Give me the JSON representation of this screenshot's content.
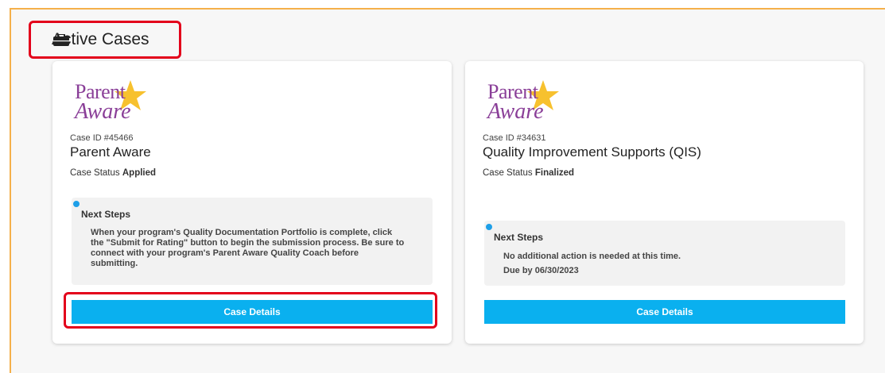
{
  "header": {
    "title": "Active Cases",
    "icon": "briefcase-icon"
  },
  "colors": {
    "accent_border": "#f5b04a",
    "highlight": "#e3001b",
    "button": "#0ab0ef",
    "logo_purple": "#8a3f98",
    "logo_star": "#f7c12e"
  },
  "cards": [
    {
      "logo": {
        "top": "Parent",
        "bottom": "Aware"
      },
      "case_id": "Case ID #45466",
      "name": "Parent Aware",
      "status_label": "Case Status",
      "status_value": "Applied",
      "next_steps_title": "Next Steps",
      "next_steps_lines": [
        "When your program's Quality Documentation Portfolio is complete, click",
        "the \"Submit for Rating\" button to begin the submission process. Be sure to",
        "connect with your program's Parent Aware Quality Coach before",
        "submitting."
      ],
      "button_label": "Case Details"
    },
    {
      "logo": {
        "top": "Parent",
        "bottom": "Aware"
      },
      "case_id": "Case ID #34631",
      "name": "Quality Improvement Supports (QIS)",
      "status_label": "Case Status",
      "status_value": "Finalized",
      "next_steps_title": "Next Steps",
      "next_steps_lines": [
        "No additional action is needed at this time.",
        "Due by 06/30/2023"
      ],
      "button_label": "Case Details"
    }
  ]
}
